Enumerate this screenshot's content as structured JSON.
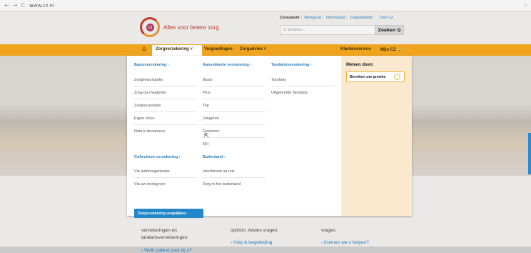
{
  "browser": {
    "back": "←",
    "forward": "→",
    "reload": "C",
    "url": "www.cz.nl",
    "star": "☆"
  },
  "header": {
    "logo_text": "CZ",
    "tagline": "Alles voor betere zorg",
    "toplinks": [
      "Consument",
      "Werkgever",
      "Intermediair",
      "Zorgaanbieder",
      "Over CZ"
    ],
    "search_placeholder": "Q Zoeken...",
    "search_button": "Zoeken Q"
  },
  "nav": {
    "home_icon": "home-icon",
    "items": [
      "Zorgverzekering",
      "Vergoedingen",
      "Zorgadvies"
    ],
    "right_items": [
      "Klantenservice",
      "Mijn CZ"
    ]
  },
  "menu": {
    "col1_head": "Basisverzekering",
    "col1": [
      "Zorgbewustpolis",
      "Zorg-op-maatpolis",
      "Zorgkeuzepolis",
      "Eigen risico",
      "Nota's declareren"
    ],
    "col1b_head": "Collectieve verzekering",
    "col1b": [
      "Via ledenorganisatie",
      "Via uw werkgever"
    ],
    "col2_head": "Aanvullende verzekering",
    "col2": [
      "Basis",
      "Plus",
      "Top",
      "Jongeren",
      "Gezinnen",
      "50+"
    ],
    "col2b_head": "Buitenland",
    "col2b": [
      "Voorbereid op reis",
      "Zorg in het buitenland"
    ],
    "col3_head": "Tandartsverzekering",
    "col3": [
      "Tandarts",
      "Uitgebreide Tandarts"
    ],
    "compare_button": "Zorgverzekering vergelijken",
    "side_title": "Meteen doen:",
    "premie_button": "Bereken uw premie"
  },
  "below": {
    "text1a": "verzekeringen en",
    "text1b": "tandartsverzekeringen.",
    "link1": "Welk pakket past bij u?",
    "text2": "opinion. Advies vragen.",
    "link2": "Hulp & begeleiding",
    "text3": "vragen.",
    "link3": "Kunnen we u helpen?"
  },
  "colors": {
    "orange": "#f0a41e",
    "blue": "#2b7bb9",
    "red": "#c0392b"
  }
}
